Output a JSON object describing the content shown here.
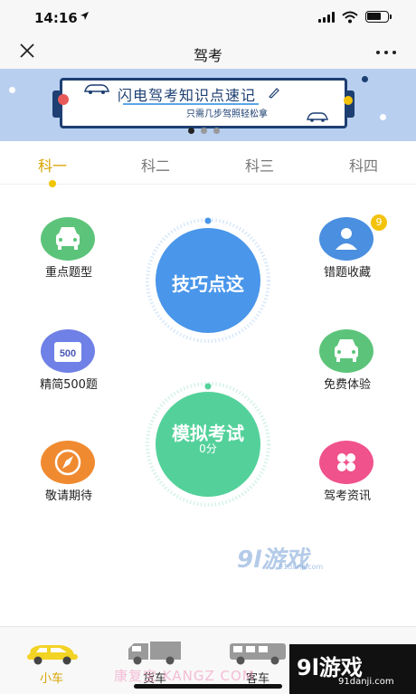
{
  "status_bar": {
    "time": "14:16",
    "location_icon": "location-arrow-icon"
  },
  "nav": {
    "title": "驾考"
  },
  "banner": {
    "title": "闪电驾考知识点速记",
    "subtitle": "只需几步驾照轻松拿"
  },
  "subject_tabs": [
    {
      "label": "科一",
      "active": true
    },
    {
      "label": "科二",
      "active": false
    },
    {
      "label": "科三",
      "active": false
    },
    {
      "label": "科四",
      "active": false
    }
  ],
  "features": {
    "key_questions": {
      "label": "重点题型",
      "color": "#5cc47a"
    },
    "wrong_collection": {
      "label": "错题收藏",
      "color": "#4a8fe0",
      "badge": "9"
    },
    "simplified_500": {
      "label": "精简500题",
      "icon_text": "500",
      "color": "#6f80e6"
    },
    "free_trial": {
      "label": "免费体验",
      "color": "#5cc47a"
    },
    "coming_soon": {
      "label": "敬请期待",
      "color": "#f08a30"
    },
    "exam_news": {
      "label": "驾考资讯",
      "color": "#f0528c"
    }
  },
  "skills_button": {
    "label": "技巧点这",
    "color": "#4a96ea"
  },
  "mock_exam": {
    "label": "模拟考试",
    "score": "0分",
    "color": "#54d19b"
  },
  "watermark": {
    "text": "9l游戏",
    "sub": "91danji.com"
  },
  "bottom_nav": [
    {
      "label": "小车",
      "active": true
    },
    {
      "label": "货车",
      "active": false
    },
    {
      "label": "客车",
      "active": false
    }
  ],
  "bottom_watermark": "康复宝 KANGZ  COM",
  "logo": {
    "text": "9l游戏",
    "sub": "91danji.com"
  }
}
